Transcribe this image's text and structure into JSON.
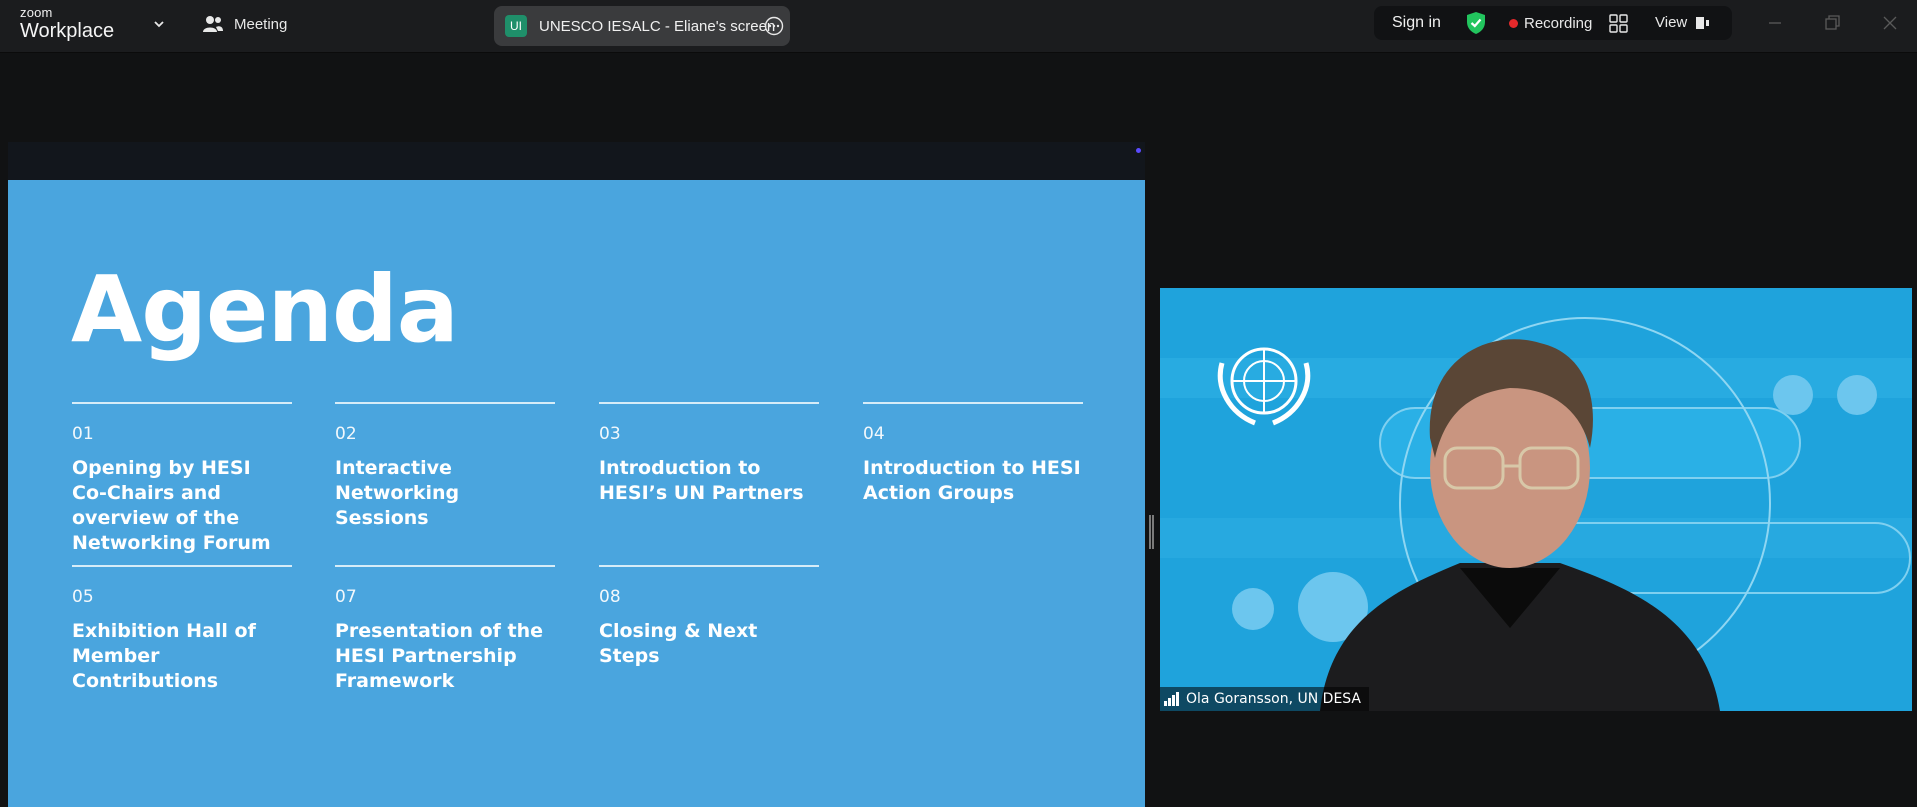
{
  "app": {
    "logo_line1": "zoom",
    "logo_line2": "Workplace",
    "meeting_label": "Meeting",
    "share_badge": "UI",
    "share_title": "UNESCO IESALC - Eliane's screen",
    "sign_in": "Sign in",
    "recording": "Recording",
    "view": "View"
  },
  "colors": {
    "slide_bg": "#4aa5de",
    "video_bg": "#1fa3dc",
    "record_dot": "#e5292b",
    "shield": "#22c55e"
  },
  "slide": {
    "title": "Agenda",
    "items": [
      {
        "num": "01",
        "text": "Opening by HESI Co-Chairs and overview of the Networking Forum"
      },
      {
        "num": "02",
        "text": "Interactive Networking Sessions"
      },
      {
        "num": "03",
        "text": "Introduction to HESI’s UN Partners"
      },
      {
        "num": "04",
        "text": "Introduction to HESI Action Groups"
      },
      {
        "num": "05",
        "text": "Exhibition Hall of Member Contributions"
      },
      {
        "num": "07",
        "text": "Presentation of the HESI Partnership Framework"
      },
      {
        "num": "08",
        "text": "Closing & Next Steps"
      }
    ]
  },
  "video": {
    "participant_name": "Ola Goransson, UN DESA"
  }
}
